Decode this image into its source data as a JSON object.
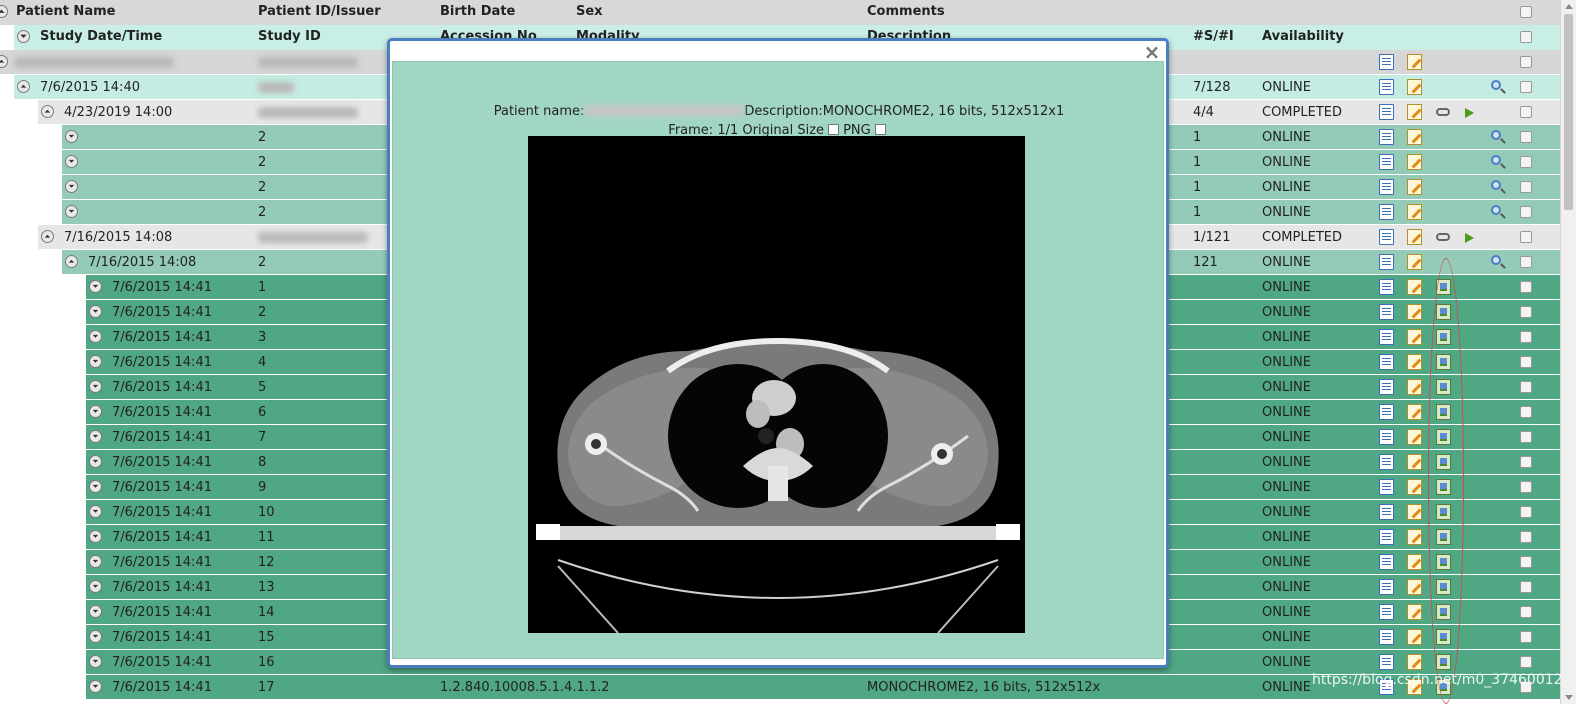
{
  "columns_row1": {
    "patient_name": "Patient Name",
    "patient_id": "Patient ID/Issuer",
    "birth_date": "Birth Date",
    "sex": "Sex",
    "comments": "Comments"
  },
  "columns_row2": {
    "study_date": "Study Date/Time",
    "study_id": "Study ID",
    "accession": "Accession No",
    "modality": "Modality",
    "description": "Description",
    "series_instances": "#S/#I",
    "availability": "Availability"
  },
  "studies": [
    {
      "date": "7/6/2015 14:40",
      "count": "7/128",
      "status": "ONLINE"
    }
  ],
  "sub_studies": [
    {
      "date": "4/23/2019 14:00",
      "count": "4/4",
      "status": "COMPLETED"
    },
    {
      "date": "7/16/2015 14:08",
      "count": "1/121",
      "status": "COMPLETED"
    }
  ],
  "series_a": [
    {
      "id": "2",
      "count": "1",
      "status": "ONLINE"
    },
    {
      "id": "2",
      "count": "1",
      "status": "ONLINE"
    },
    {
      "id": "2",
      "count": "1",
      "status": "ONLINE"
    },
    {
      "id": "2",
      "count": "1",
      "status": "ONLINE"
    }
  ],
  "series_b": {
    "date": "7/16/2015 14:08",
    "id": "2",
    "count": "121",
    "status": "ONLINE"
  },
  "instances": [
    {
      "date": "7/6/2015 14:41",
      "num": "1",
      "status": "ONLINE"
    },
    {
      "date": "7/6/2015 14:41",
      "num": "2",
      "status": "ONLINE"
    },
    {
      "date": "7/6/2015 14:41",
      "num": "3",
      "status": "ONLINE"
    },
    {
      "date": "7/6/2015 14:41",
      "num": "4",
      "status": "ONLINE"
    },
    {
      "date": "7/6/2015 14:41",
      "num": "5",
      "status": "ONLINE"
    },
    {
      "date": "7/6/2015 14:41",
      "num": "6",
      "status": "ONLINE"
    },
    {
      "date": "7/6/2015 14:41",
      "num": "7",
      "status": "ONLINE"
    },
    {
      "date": "7/6/2015 14:41",
      "num": "8",
      "status": "ONLINE"
    },
    {
      "date": "7/6/2015 14:41",
      "num": "9",
      "status": "ONLINE"
    },
    {
      "date": "7/6/2015 14:41",
      "num": "10",
      "status": "ONLINE"
    },
    {
      "date": "7/6/2015 14:41",
      "num": "11",
      "status": "ONLINE"
    },
    {
      "date": "7/6/2015 14:41",
      "num": "12",
      "status": "ONLINE"
    },
    {
      "date": "7/6/2015 14:41",
      "num": "13",
      "status": "ONLINE"
    },
    {
      "date": "7/6/2015 14:41",
      "num": "14",
      "status": "ONLINE"
    },
    {
      "date": "7/6/2015 14:41",
      "num": "15",
      "status": "ONLINE"
    },
    {
      "date": "7/6/2015 14:41",
      "num": "16",
      "status": "ONLINE"
    },
    {
      "date": "7/6/2015 14:41",
      "num": "17",
      "uid": "1.2.840.10008.5.1.4.1.1.2",
      "desc": "MONOCHROME2, 16 bits, 512x512x",
      "status": "ONLINE"
    }
  ],
  "modal": {
    "close": "×",
    "patient_label": "Patient name:",
    "description": "Description:MONOCHROME2, 16 bits, 512x512x1",
    "frame": "Frame: 1/1 Original Size",
    "png": "PNG"
  },
  "watermark": "https://blog.csdn.net/m0_37460012",
  "colors": {
    "header": "#d8d8d8",
    "study": "#c4ece2",
    "series": "#93cbb7",
    "instance": "#4fa784",
    "modal_bg": "#a1d6c3",
    "modal_border": "#4a7ec0"
  },
  "icons": [
    "document-icon",
    "edit-icon",
    "image-icon",
    "link-icon",
    "arrow-icon",
    "magnifier-icon",
    "toggle-icon",
    "close-icon"
  ]
}
